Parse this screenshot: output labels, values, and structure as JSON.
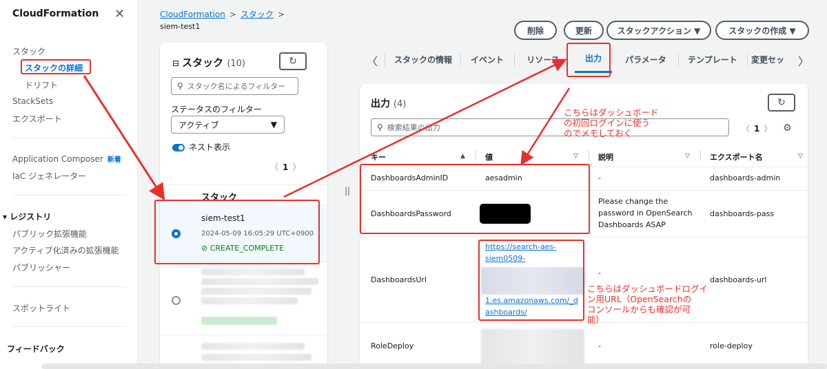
{
  "nav": {
    "title": "CloudFormation",
    "items": [
      {
        "label": "スタック"
      },
      {
        "label": "スタックの詳細"
      },
      {
        "label": "ドリフト"
      },
      {
        "label": "StackSets"
      },
      {
        "label": "エクスポート"
      },
      {
        "label": "Application Composer"
      },
      {
        "label": "IaC ジェネレーター"
      },
      {
        "label": "レジストリ"
      },
      {
        "label": "パブリック拡張機能"
      },
      {
        "label": "アクティブ化済みの拡張機能"
      },
      {
        "label": "パブリッシャー"
      },
      {
        "label": "スポットライト"
      },
      {
        "label": "フィードバック"
      }
    ],
    "new_badge": "新着"
  },
  "breadcrumb": {
    "root": "CloudFormation",
    "stacks": "スタック",
    "current": "siem-test1"
  },
  "stack_list": {
    "title": "スタック",
    "count": "(10)",
    "filter_placeholder": "スタック名によるフィルター",
    "status_filter_label": "ステータスのフィルター",
    "status_filter_value": "アクティブ",
    "nested_label": "ネスト表示",
    "page": "1",
    "column": "スタック",
    "selected": {
      "name": "siem-test1",
      "time": "2024-05-09 16:05:29 UTC+0900",
      "status": "CREATE_COMPLETE"
    }
  },
  "actions": {
    "delete": "削除",
    "update": "更新",
    "stack_actions": "スタックアクション ▼",
    "create_stack": "スタックの作成 ▼"
  },
  "tabs": [
    "スタックの情報",
    "イベント",
    "リソース",
    "出力",
    "パラメータ",
    "テンプレート",
    "変更セッ"
  ],
  "outputs": {
    "title": "出力",
    "count": "(4)",
    "search_placeholder": "検索結果の出力",
    "page": "1",
    "columns": {
      "key": "キー",
      "value": "値",
      "description": "説明",
      "export": "エクスポート名"
    },
    "rows": [
      {
        "key": "DashboardsAdminID",
        "value": "aesadmin",
        "description": "-",
        "export": "dashboards-admin"
      },
      {
        "key": "DashboardsPassword",
        "value": "",
        "description": "Please change the password in OpenSearch Dashboards ASAP",
        "export": "dashboards-pass"
      },
      {
        "key": "DashboardsUrl",
        "value_line1": "https://search-aes-",
        "value_line2": "siem0509-",
        "value_line3": "1.es.amazonaws.com/_d",
        "value_line4": "ashboards/",
        "description": "-",
        "export": "dashboards-url"
      },
      {
        "key": "RoleDeploy",
        "value": "",
        "description": "-",
        "export": "role-deploy"
      }
    ]
  },
  "annotations": {
    "note1": "こちらはダッシュボード\nの初回ログインに使う\nのでメモしておく",
    "note2": "こちらはダッシュボードログイ\nン用URL（OpenSearchの\nコンソールからも確認が可\n能）"
  },
  "colors": {
    "accent": "#0972d3",
    "annotation": "#e8302b",
    "success": "#037f0c"
  }
}
